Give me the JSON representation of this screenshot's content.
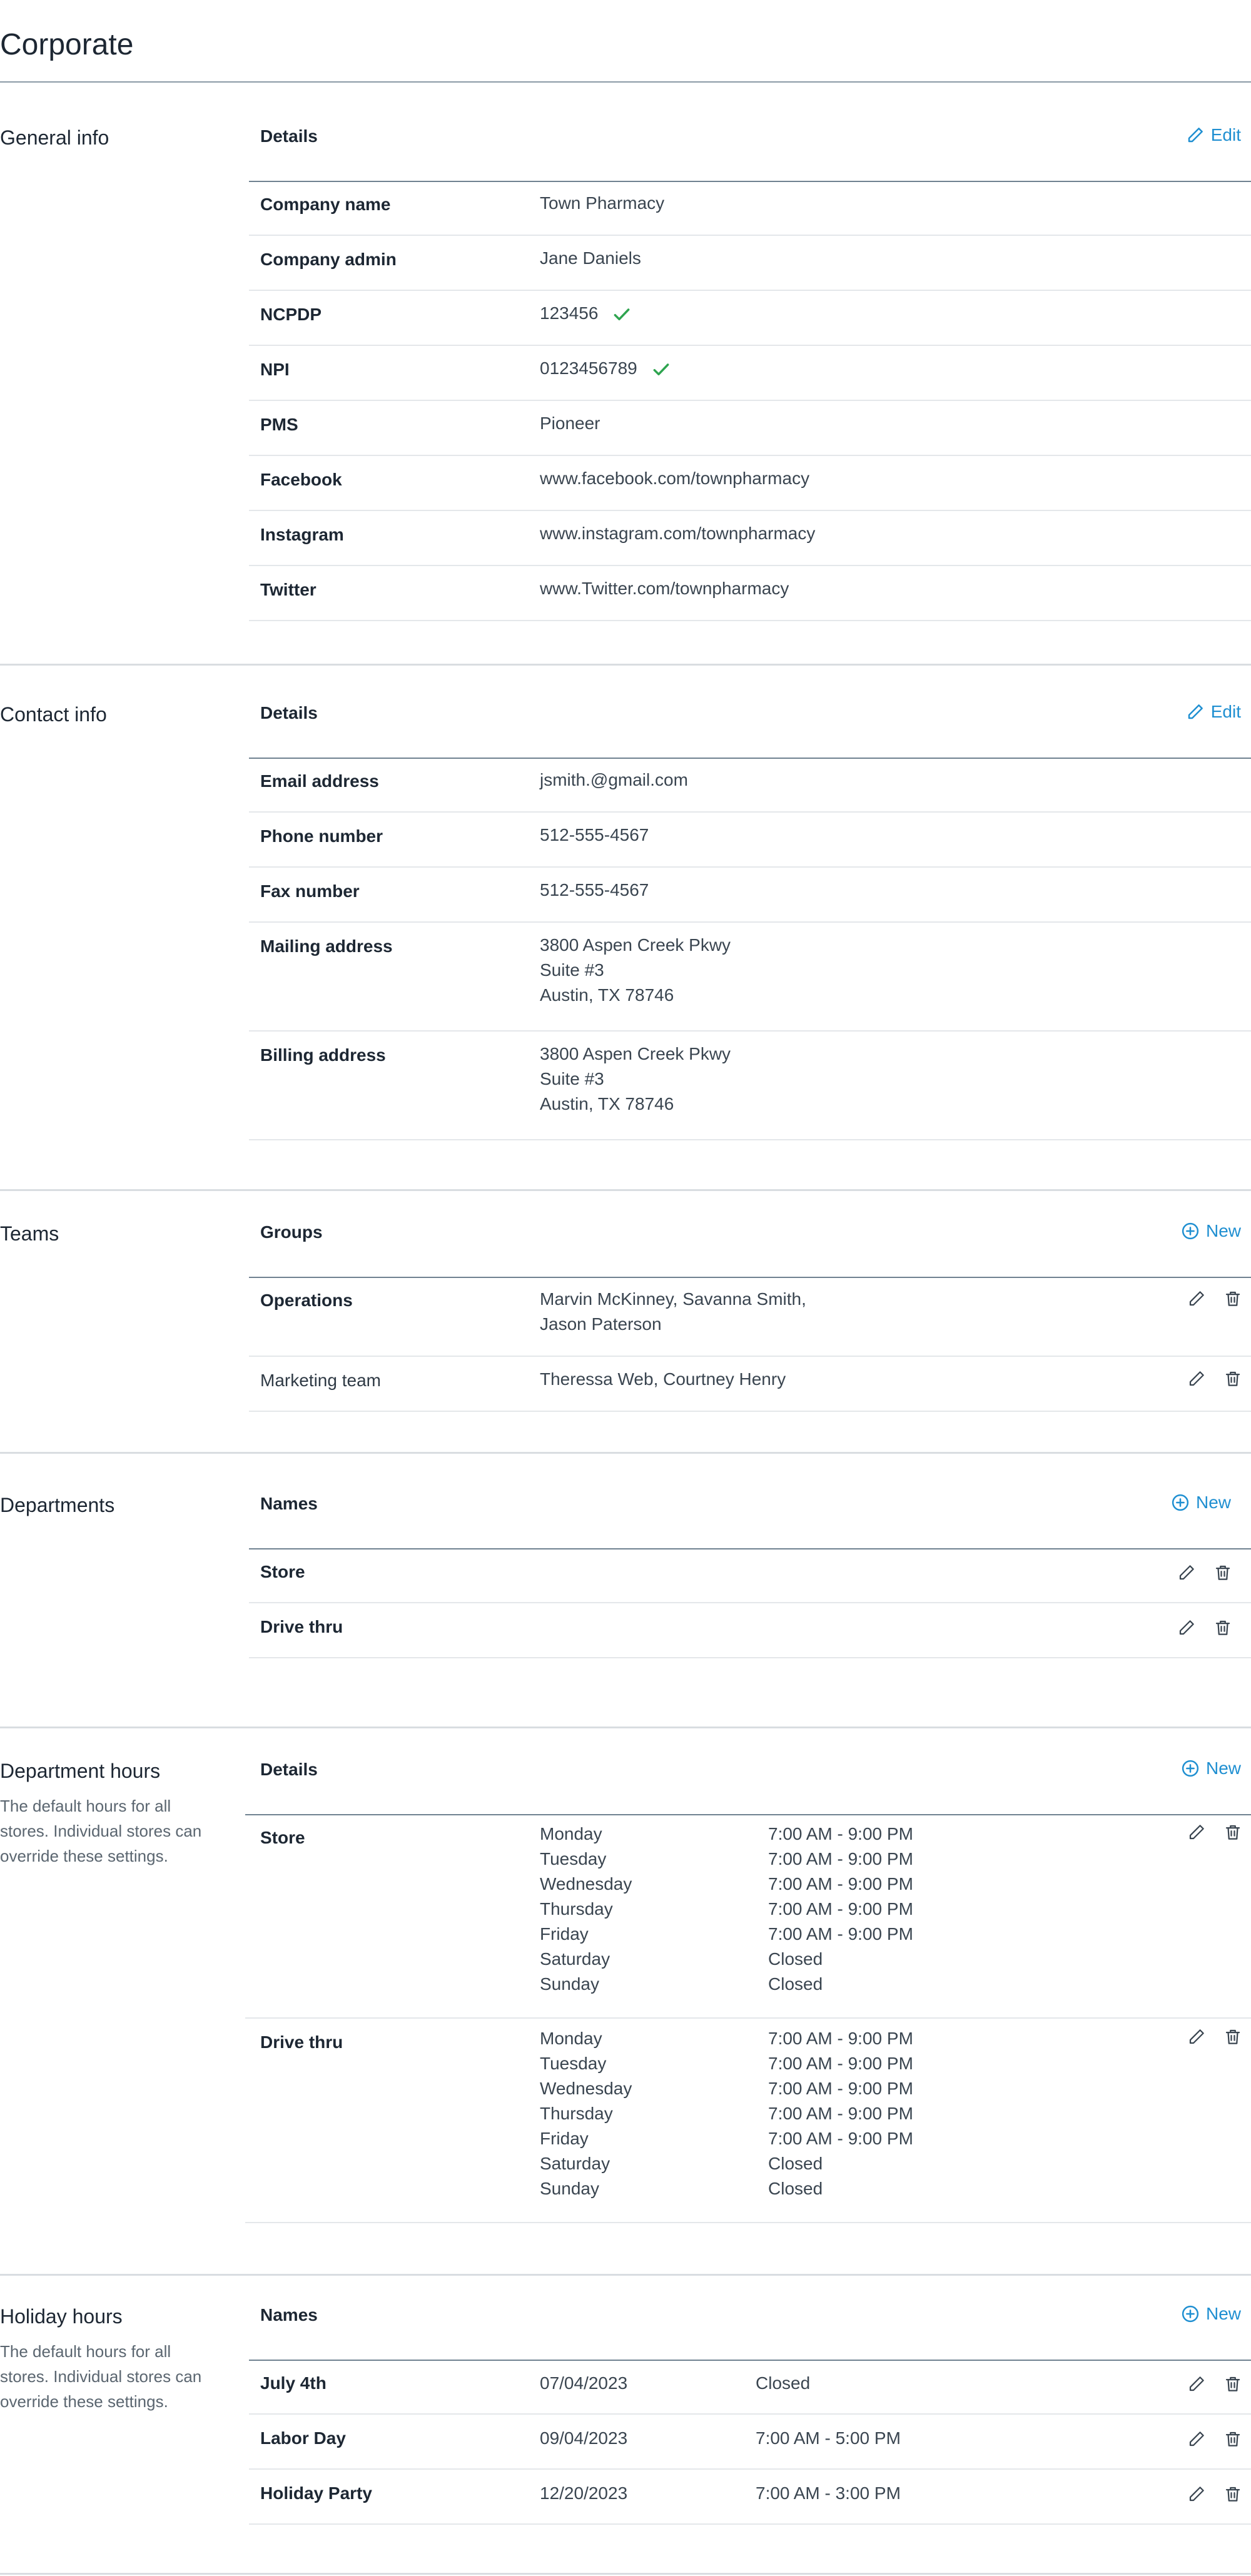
{
  "page": {
    "title": "Corporate"
  },
  "colors": {
    "accent": "#1f8fd1",
    "check": "#2ea44f",
    "text": "#1d2733"
  },
  "general": {
    "title": "General info",
    "header": "Details",
    "edit_label": "Edit",
    "rows": [
      {
        "label": "Company name",
        "value": "Town Pharmacy"
      },
      {
        "label": "Company admin",
        "value": "Jane Daniels"
      },
      {
        "label": "NCPDP",
        "value": "123456",
        "verified": true
      },
      {
        "label": "NPI",
        "value": "0123456789",
        "verified": true
      },
      {
        "label": "PMS",
        "value": "Pioneer"
      },
      {
        "label": "Facebook",
        "value": "www.facebook.com/townpharmacy"
      },
      {
        "label": "Instagram",
        "value": "www.instagram.com/townpharmacy"
      },
      {
        "label": "Twitter",
        "value": "www.Twitter.com/townpharmacy"
      }
    ]
  },
  "contact": {
    "title": "Contact info",
    "header": "Details",
    "edit_label": "Edit",
    "rows": [
      {
        "label": "Email address",
        "lines": [
          "jsmith.@gmail.com"
        ]
      },
      {
        "label": "Phone number",
        "lines": [
          "512-555-4567"
        ]
      },
      {
        "label": "Fax number",
        "lines": [
          "512-555-4567"
        ]
      },
      {
        "label": "Mailing address",
        "lines": [
          "3800 Aspen Creek Pkwy",
          "Suite #3",
          "Austin, TX 78746"
        ]
      },
      {
        "label": "Billing address",
        "lines": [
          "3800 Aspen Creek Pkwy",
          "Suite #3",
          "Austin, TX 78746"
        ]
      }
    ]
  },
  "teams": {
    "title": "Teams",
    "header": "Groups",
    "new_label": "New",
    "rows": [
      {
        "label": "Operations",
        "lines": [
          "Marvin McKinney, Savanna Smith,",
          "Jason Paterson"
        ]
      },
      {
        "label": "Marketing team",
        "lines": [
          "Theressa Web, Courtney Henry"
        ]
      }
    ]
  },
  "departments": {
    "title": "Departments",
    "header": "Names",
    "new_label": "New",
    "rows": [
      {
        "label": "Store"
      },
      {
        "label": "Drive thru"
      }
    ]
  },
  "dept_hours": {
    "title": "Department hours",
    "description": "The default hours for all stores. Individual stores can override these settings.",
    "header": "Details",
    "new_label": "New",
    "days": [
      "Monday",
      "Tuesday",
      "Wednesday",
      "Thursday",
      "Friday",
      "Saturday",
      "Sunday"
    ],
    "rows": [
      {
        "label": "Store",
        "hours": [
          "7:00 AM - 9:00 PM",
          "7:00 AM - 9:00 PM",
          "7:00 AM - 9:00 PM",
          "7:00 AM - 9:00 PM",
          "7:00 AM - 9:00 PM",
          "Closed",
          "Closed"
        ]
      },
      {
        "label": "Drive thru",
        "hours": [
          "7:00 AM - 9:00 PM",
          "7:00 AM - 9:00 PM",
          "7:00 AM - 9:00 PM",
          "7:00 AM - 9:00 PM",
          "7:00 AM - 9:00 PM",
          "Closed",
          "Closed"
        ]
      }
    ]
  },
  "holiday": {
    "title": "Holiday hours",
    "description": "The default hours for all stores. Individual stores can override these settings.",
    "header": "Names",
    "new_label": "New",
    "rows": [
      {
        "label": "July 4th",
        "date": "07/04/2023",
        "hours": "Closed"
      },
      {
        "label": "Labor Day",
        "date": "09/04/2023",
        "hours": "7:00 AM - 5:00 PM"
      },
      {
        "label": "Holiday Party",
        "date": "12/20/2023",
        "hours": "7:00 AM - 3:00 PM"
      }
    ]
  }
}
